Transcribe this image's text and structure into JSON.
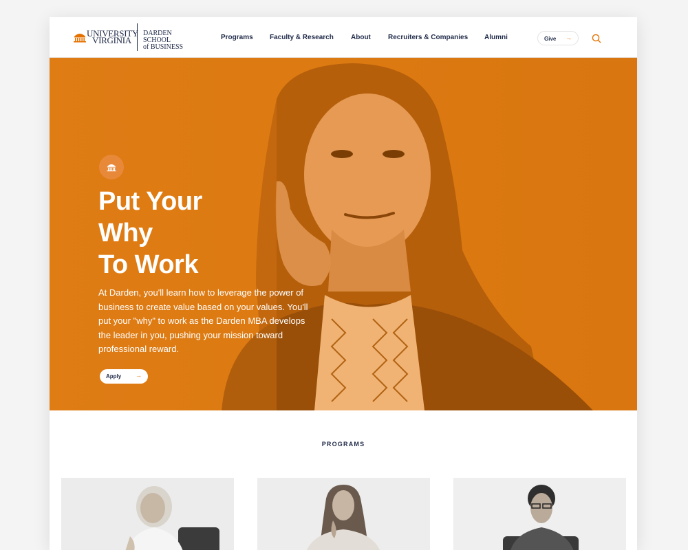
{
  "logo": {
    "university_line1": "UNIVERSITY",
    "university_line2": "VIRGINIA",
    "school_line1": "DARDEN SCHOOL",
    "school_line2": "of BUSINESS"
  },
  "nav": {
    "items": [
      {
        "label": "Programs"
      },
      {
        "label": "Faculty & Research"
      },
      {
        "label": "About"
      },
      {
        "label": "Recruiters & Companies"
      },
      {
        "label": "Alumni"
      }
    ],
    "give_label": "Give",
    "give_arrow": "→"
  },
  "hero": {
    "title_lines": [
      "Put Your",
      "Why",
      "To Work"
    ],
    "body": "At Darden, you'll learn how to leverage the power of business to create value based on your values. You'll put your \"why\" to work as the Darden MBA develops the leader in you, pushing your mission toward professional reward.",
    "apply_label": "Apply",
    "apply_arrow": "→"
  },
  "programs": {
    "heading": "PROGRAMS"
  },
  "colors": {
    "brand_orange": "#e57200",
    "hero_orange": "#dd7a13",
    "navy": "#232d4b"
  },
  "icons": {
    "rotunda": "rotunda-icon",
    "search": "search-icon",
    "arrow": "arrow-right-icon"
  }
}
